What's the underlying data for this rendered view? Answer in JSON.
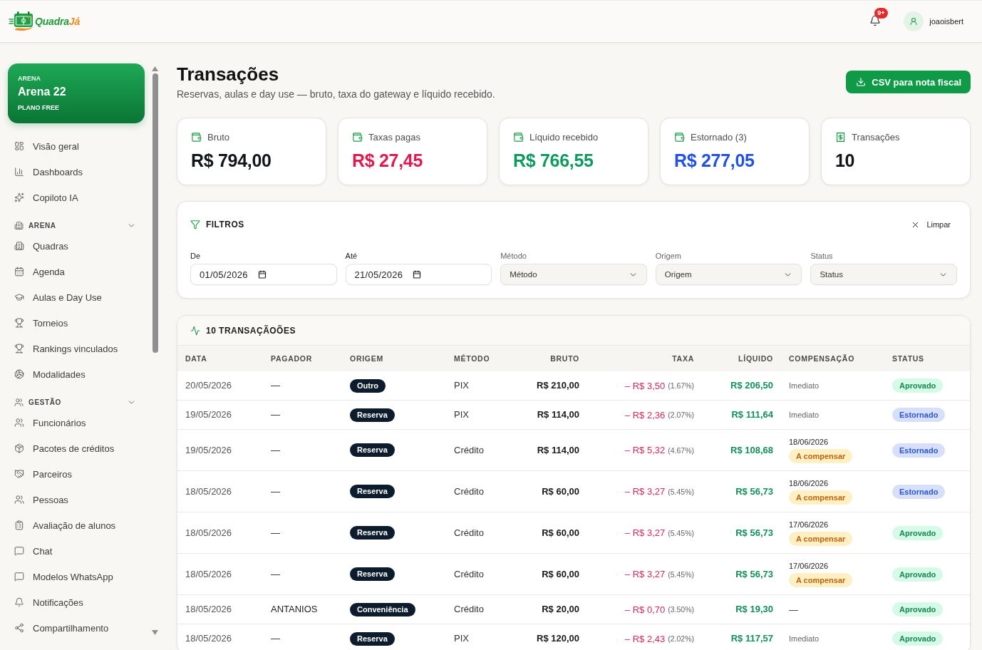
{
  "brand": {
    "name": "Quadra",
    "accent": "Já"
  },
  "header": {
    "notifications": "9+",
    "user": "joaoisbert"
  },
  "sidebar": {
    "arena": {
      "caption": "ARENA",
      "name": "Arena 22",
      "plan": "PLANO FREE"
    },
    "items": [
      {
        "label": "Visão geral",
        "selected": false
      },
      {
        "label": "Dashboards",
        "selected": false
      },
      {
        "label": "Copiloto IA",
        "selected": false
      }
    ],
    "sections": [
      {
        "title": "ARENA",
        "expanded": true,
        "items": [
          {
            "label": "Quadras",
            "selected": false
          },
          {
            "label": "Agenda",
            "selected": false
          },
          {
            "label": "Aulas e Day Use",
            "selected": false
          },
          {
            "label": "Torneios",
            "selected": false
          },
          {
            "label": "Rankings vinculados",
            "selected": false
          },
          {
            "label": "Modalidades",
            "selected": false
          }
        ]
      },
      {
        "title": "GESTÃO",
        "expanded": true,
        "items": [
          {
            "label": "Funcionários",
            "selected": false
          },
          {
            "label": "Pacotes de créditos",
            "selected": false
          },
          {
            "label": "Parceiros",
            "selected": false
          },
          {
            "label": "Pessoas",
            "selected": false
          },
          {
            "label": "Avaliação de alunos",
            "selected": false
          },
          {
            "label": "Chat",
            "selected": false
          },
          {
            "label": "Modelos WhatsApp",
            "selected": false
          },
          {
            "label": "Notificações",
            "selected": false
          },
          {
            "label": "Compartilhamento",
            "selected": false
          }
        ]
      }
    ]
  },
  "page": {
    "title": "Transações",
    "subtitle": "Reservas, aulas e day use — bruto, taxa do gateway e líquido recebido.",
    "export_button": "CSV para nota fiscal"
  },
  "kpis": [
    {
      "kind": "money",
      "label": "Bruto",
      "value": "R$ 794,00",
      "color": "#111418"
    },
    {
      "kind": "money",
      "label": "Taxas pagas",
      "value": "R$ 27,45",
      "color": "#e0194f"
    },
    {
      "kind": "money",
      "label": "Líquido recebido",
      "value": "R$ 766,55",
      "color": "#0f9a62"
    },
    {
      "kind": "money",
      "label": "Estornado (3)",
      "value": "R$ 277,05",
      "color": "#2152e3"
    },
    {
      "kind": "count",
      "label": "Transações",
      "value": "10",
      "color": "#111418"
    }
  ],
  "filters": {
    "title": "FILTROS",
    "clear": "Limpar",
    "fields": [
      {
        "kind": "date",
        "label": "De",
        "value": "01/05/2026"
      },
      {
        "kind": "date",
        "label": "Até",
        "value": "21/05/2026"
      },
      {
        "kind": "select",
        "label": "Método",
        "placeholder": "Método"
      },
      {
        "kind": "select",
        "label": "Origem",
        "placeholder": "Origem"
      },
      {
        "kind": "select",
        "label": "Status",
        "placeholder": "Status"
      }
    ]
  },
  "table": {
    "title": "10 TRANSAÇÃOÕES",
    "columns": [
      "DATA",
      "PAGADOR",
      "ORIGEM",
      "MÉTODO",
      "BRUTO",
      "TAXA",
      "LÍQUIDO",
      "COMPENSAÇÃO",
      "STATUS"
    ],
    "rows": [
      {
        "date": "20/05/2026",
        "payer": "—",
        "origin": "Outro",
        "method": "PIX",
        "gross": "R$ 210,00",
        "fee": "– R$ 3,50",
        "fee_pct": "(1.67%)",
        "net": "R$ 206,50",
        "compensation": {
          "kind": "immediate",
          "text": "Imediato"
        },
        "status": {
          "label": "Aprovado",
          "color": "#16884f"
        }
      },
      {
        "date": "19/05/2026",
        "payer": "—",
        "origin": "Reserva",
        "method": "PIX",
        "gross": "R$ 114,00",
        "fee": "– R$ 2,36",
        "fee_pct": "(2.07%)",
        "net": "R$ 111,64",
        "compensation": {
          "kind": "immediate",
          "text": "Imediato"
        },
        "status": {
          "label": "Estornado",
          "color": "#2a55d4"
        }
      },
      {
        "date": "19/05/2026",
        "payer": "—",
        "origin": "Reserva",
        "method": "Crédito",
        "gross": "R$ 114,00",
        "fee": "– R$ 5,32",
        "fee_pct": "(4.67%)",
        "net": "R$ 108,68",
        "compensation": {
          "kind": "scheduled",
          "date": "18/06/2026",
          "badge": "A compensar"
        },
        "status": {
          "label": "Estornado",
          "color": "#2a55d4"
        }
      },
      {
        "date": "18/05/2026",
        "payer": "—",
        "origin": "Reserva",
        "method": "Crédito",
        "gross": "R$ 60,00",
        "fee": "– R$ 3,27",
        "fee_pct": "(5.45%)",
        "net": "R$ 56,73",
        "compensation": {
          "kind": "scheduled",
          "date": "18/06/2026",
          "badge": "A compensar"
        },
        "status": {
          "label": "Estornado",
          "color": "#2a55d4"
        }
      },
      {
        "date": "18/05/2026",
        "payer": "—",
        "origin": "Reserva",
        "method": "Crédito",
        "gross": "R$ 60,00",
        "fee": "– R$ 3,27",
        "fee_pct": "(5.45%)",
        "net": "R$ 56,73",
        "compensation": {
          "kind": "scheduled",
          "date": "17/06/2026",
          "badge": "A compensar"
        },
        "status": {
          "label": "Aprovado",
          "color": "#16884f"
        }
      },
      {
        "date": "18/05/2026",
        "payer": "—",
        "origin": "Reserva",
        "method": "Crédito",
        "gross": "R$ 60,00",
        "fee": "– R$ 3,27",
        "fee_pct": "(5.45%)",
        "net": "R$ 56,73",
        "compensation": {
          "kind": "scheduled",
          "date": "17/06/2026",
          "badge": "A compensar"
        },
        "status": {
          "label": "Aprovado",
          "color": "#16884f"
        }
      },
      {
        "date": "18/05/2026",
        "payer": "ANTANIOS",
        "origin": "Conveniência",
        "method": "Crédito",
        "gross": "R$ 20,00",
        "fee": "– R$ 0,70",
        "fee_pct": "(3.50%)",
        "net": "R$ 19,30",
        "compensation": {
          "kind": "none",
          "text": "—"
        },
        "status": {
          "label": "Aprovado",
          "color": "#16884f"
        }
      },
      {
        "date": "18/05/2026",
        "payer": "—",
        "origin": "Reserva",
        "method": "PIX",
        "gross": "R$ 120,00",
        "fee": "– R$ 2,43",
        "fee_pct": "(2.02%)",
        "net": "R$ 117,57",
        "compensation": {
          "kind": "immediate",
          "text": "Imediato"
        },
        "status": {
          "label": "Aprovado",
          "color": "#16884f"
        }
      }
    ]
  }
}
